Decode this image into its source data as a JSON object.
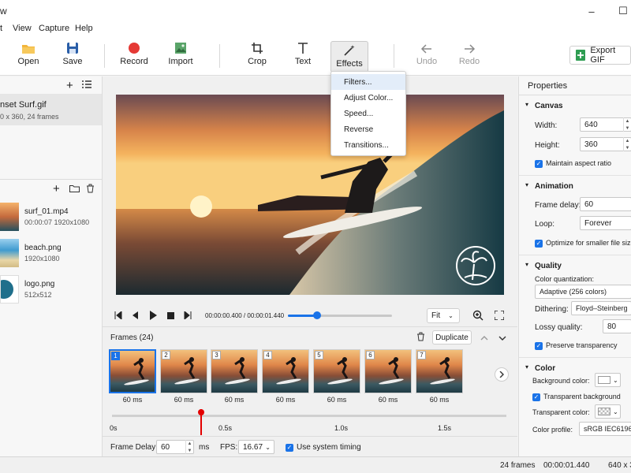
{
  "window": {
    "title": "w",
    "minimize": "–",
    "maximize": "☐"
  },
  "menu": [
    "t",
    "View",
    "Capture",
    "Help"
  ],
  "toolbar": {
    "open": "Open",
    "save": "Save",
    "record": "Record",
    "import": "Import",
    "crop": "Crop",
    "text": "Text",
    "effects": "Effects",
    "undo": "Undo",
    "redo": "Redo",
    "export": "Export GIF"
  },
  "effects_menu": [
    "Filters...",
    "Adjust Color...",
    "Speed...",
    "Reverse",
    "Transitions..."
  ],
  "project": {
    "name": "nset Surf.gif",
    "info": "0 x 360, 24 frames"
  },
  "media": [
    {
      "name": "surf_01.mp4",
      "meta": "00:00:07   1920x1080"
    },
    {
      "name": "beach.png",
      "meta": "1920x1080"
    },
    {
      "name": "logo.png",
      "meta": "512x512"
    }
  ],
  "player": {
    "time": "00:00:00.400 / 00:00:01.440",
    "zoom": "Fit",
    "position": 0.28
  },
  "frames": {
    "title": "Frames (24)",
    "duplicate": "Duplicate",
    "items": [
      {
        "n": "1",
        "d": "60 ms"
      },
      {
        "n": "2",
        "d": "60 ms"
      },
      {
        "n": "3",
        "d": "60 ms"
      },
      {
        "n": "4",
        "d": "60 ms"
      },
      {
        "n": "5",
        "d": "60 ms"
      },
      {
        "n": "6",
        "d": "60 ms"
      },
      {
        "n": "7",
        "d": "60 ms"
      }
    ],
    "timeline_ticks": [
      "0s",
      "0.5s",
      "1.0s",
      "1.5s"
    ],
    "playhead_position": 0.224,
    "delay_label": "Frame Delay:",
    "delay_value": "60",
    "delay_unit": "ms",
    "fps_label": "FPS:",
    "fps_value": "16.67",
    "system_timing": "Use system timing"
  },
  "properties": {
    "title": "Properties",
    "canvas": {
      "title": "Canvas",
      "width_label": "Width:",
      "width": "640",
      "height_label": "Height:",
      "height": "360",
      "aspect": "Maintain aspect ratio"
    },
    "animation": {
      "title": "Animation",
      "delay_label": "Frame delay:",
      "delay": "60",
      "loop_label": "Loop:",
      "loop": "Forever",
      "optimize": "Optimize for smaller file size"
    },
    "quality": {
      "title": "Quality",
      "quant_label": "Color quantization:",
      "quant": "Adaptive (256 colors)",
      "dither_label": "Dithering:",
      "dither": "Floyd–Steinberg",
      "lossy_label": "Lossy quality:",
      "lossy": "80",
      "transparency": "Preserve transparency"
    },
    "color": {
      "title": "Color",
      "bg_label": "Background color:",
      "transparent_bg": "Transparent background",
      "tcolor_label": "Transparent color:",
      "profile_label": "Color profile:",
      "profile": "sRGB IEC61966-"
    }
  },
  "status": {
    "frames": "24 frames",
    "duration": "00:00:01.440",
    "size": "640 x 3"
  },
  "colors": {
    "accent": "#1a73e8",
    "record": "#e53935",
    "playhead": "#e30000"
  }
}
